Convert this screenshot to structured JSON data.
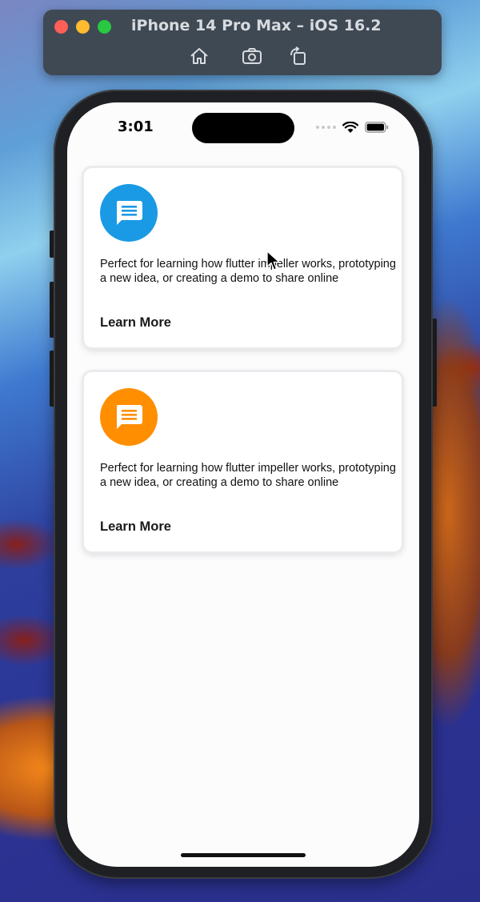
{
  "window": {
    "title": "iPhone 14 Pro Max – iOS 16.2",
    "toolbar_icons": [
      "home-icon",
      "camera-icon",
      "rotate-icon"
    ]
  },
  "status_bar": {
    "time": "3:01",
    "icons": [
      "signal-dots-icon",
      "wifi-icon",
      "battery-icon"
    ]
  },
  "cards": [
    {
      "icon": "message-icon",
      "icon_color": "#1a9ae4",
      "text": "Perfect for learning how flutter impeller works, prototyping a new idea, or creating a demo to share online",
      "link": "Learn More"
    },
    {
      "icon": "message-icon",
      "icon_color": "#ff8f00",
      "text": "Perfect for learning how flutter impeller works, prototyping a new idea, or creating a demo to share online",
      "link": "Learn More"
    }
  ],
  "colors": {
    "card_blue": "#1a9ae4",
    "card_orange": "#ff8f00",
    "screen_bg": "#fdfcfd"
  }
}
